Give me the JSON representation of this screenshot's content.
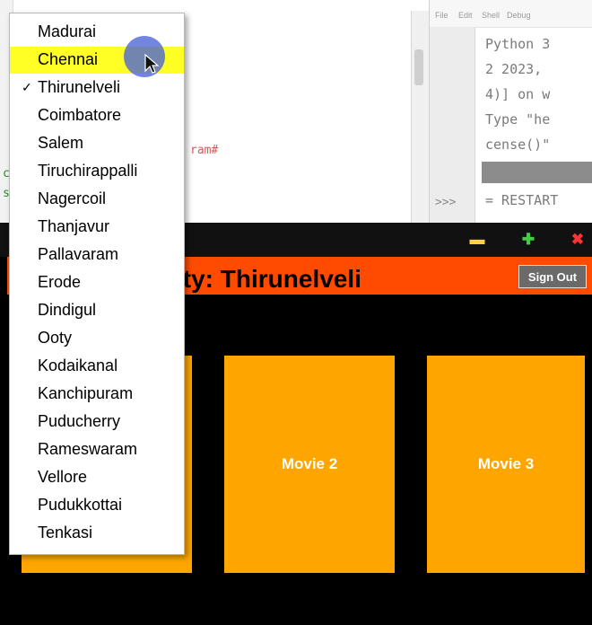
{
  "editor": {
    "code_hash": "ram#",
    "code_c": "c",
    "code_s": "s"
  },
  "shell": {
    "menu": [
      "File",
      "Edit",
      "Shell",
      "Debug"
    ],
    "lines": [
      "Python 3",
      "2 2023, ",
      "4)] on w",
      "Type \"he",
      "cense()\""
    ],
    "prompt": ">>>",
    "restart": "= RESTART"
  },
  "app": {
    "title": "ur City: Thirunelveli",
    "sign_out": "Sign Out",
    "movies": [
      "Movie 2",
      "Movie 3"
    ],
    "window_buttons": {
      "minimize": "minimize-icon",
      "maximize": "plus-icon",
      "close": "close-icon"
    },
    "colors": {
      "header": "#ff4b00",
      "movie_tile": "#ffa500",
      "background": "#000000"
    }
  },
  "dropdown": {
    "selected": "Thirunelveli",
    "hovered": "Chennai",
    "items": [
      "Madurai",
      "Chennai",
      "Thirunelveli",
      "Coimbatore",
      "Salem",
      "Tiruchirappalli",
      "Nagercoil",
      "Thanjavur",
      "Pallavaram",
      "Erode",
      "Dindigul",
      "Ooty",
      "Kodaikanal",
      "Kanchipuram",
      "Puducherry",
      "Rameswaram",
      "Vellore",
      "Pudukkottai",
      "Tenkasi"
    ],
    "check_mark": "✓"
  }
}
